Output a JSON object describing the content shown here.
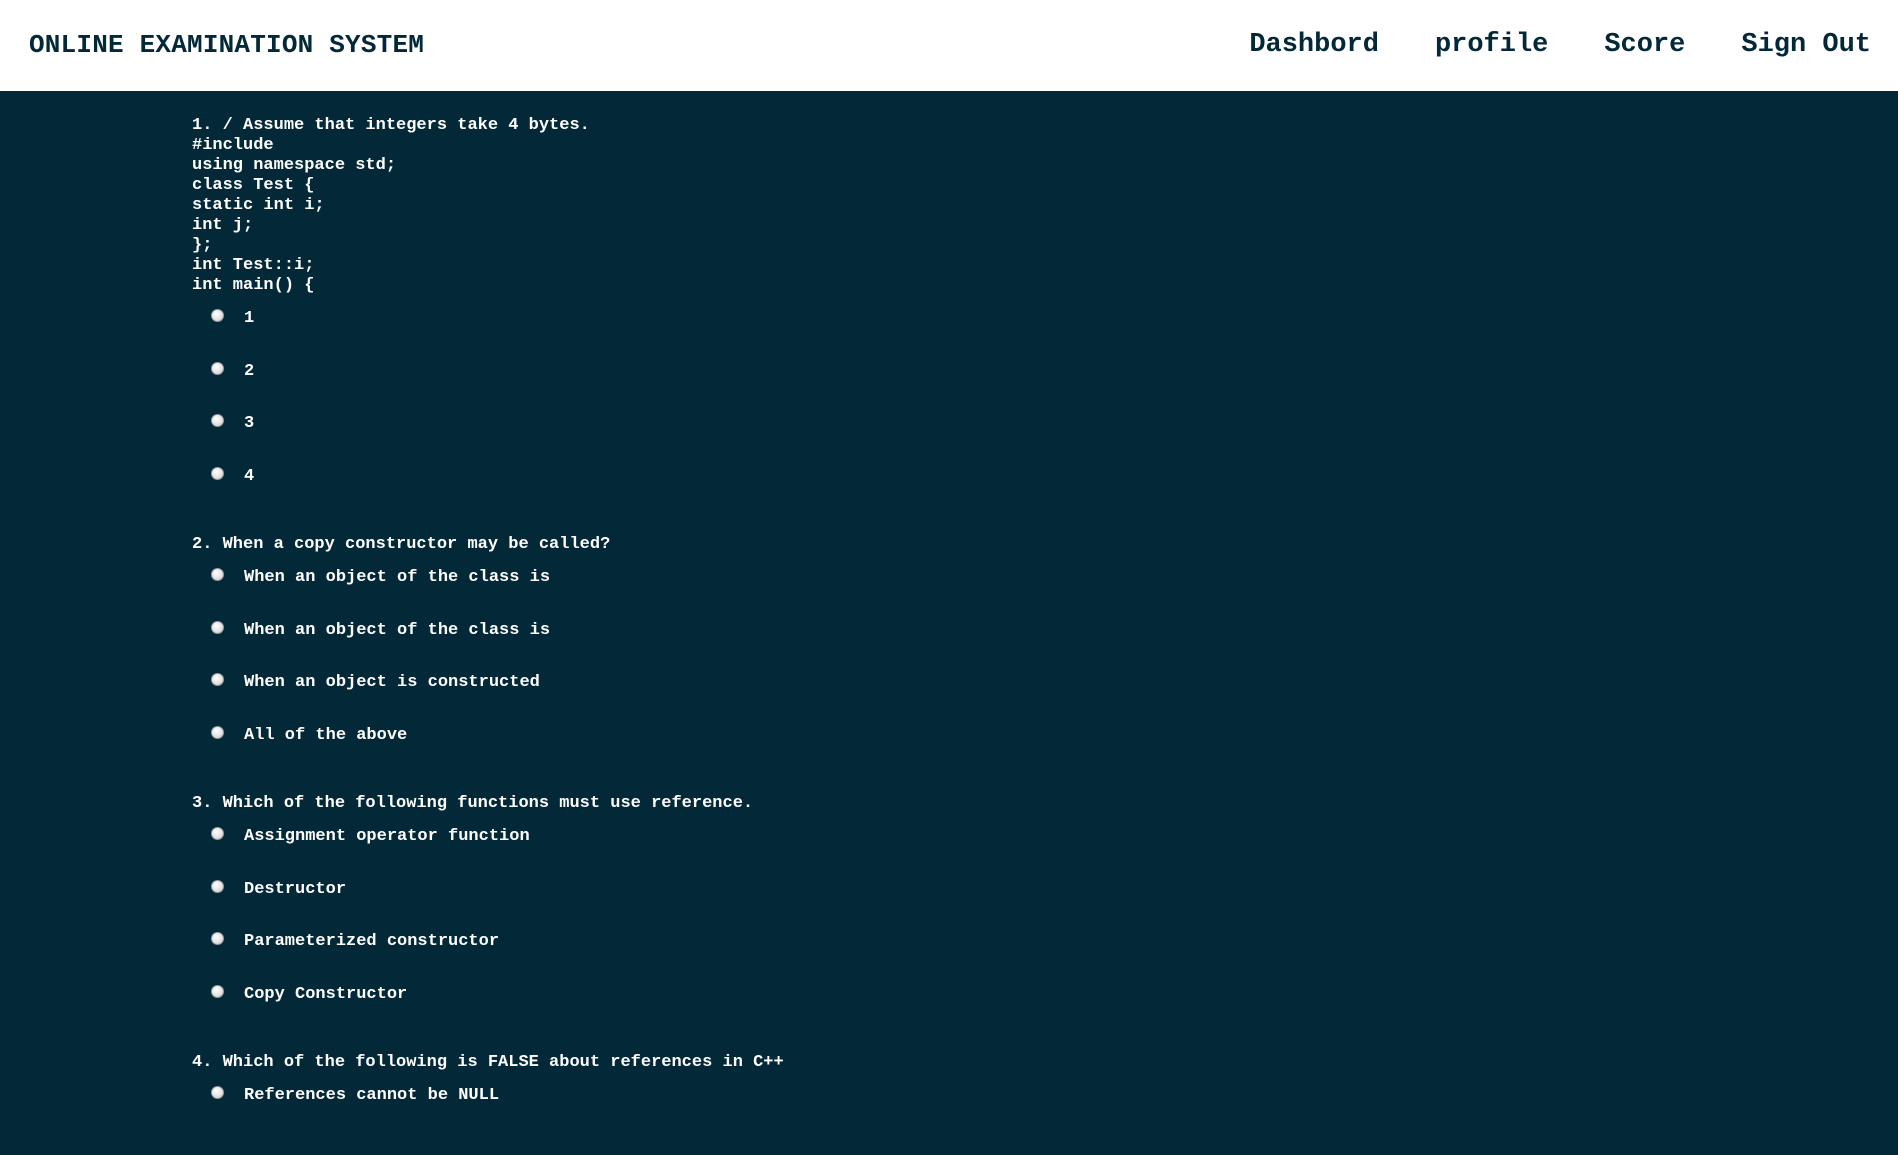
{
  "header": {
    "title": "ONLINE EXAMINATION SYSTEM",
    "nav": [
      "Dashbord",
      "profile",
      "Score",
      "Sign Out"
    ]
  },
  "questions": [
    {
      "text": "1. / Assume that integers take 4 bytes.\n#include\nusing namespace std;\nclass Test {\nstatic int i;\nint j;\n};\nint Test::i;\nint main() {",
      "options": [
        "1",
        "2",
        "3",
        "4"
      ]
    },
    {
      "text": "2. When a copy constructor may be called?",
      "options": [
        "When an object of the class is",
        "When an object of the class is",
        "When an object is constructed",
        "All of the above"
      ]
    },
    {
      "text": "3. Which of the following functions must use reference.",
      "options": [
        "Assignment operator function",
        "Destructor",
        "Parameterized constructor",
        "Copy Constructor"
      ]
    },
    {
      "text": "4. Which of the following is FALSE about references in C++",
      "options": [
        "References cannot be NULL"
      ]
    }
  ]
}
